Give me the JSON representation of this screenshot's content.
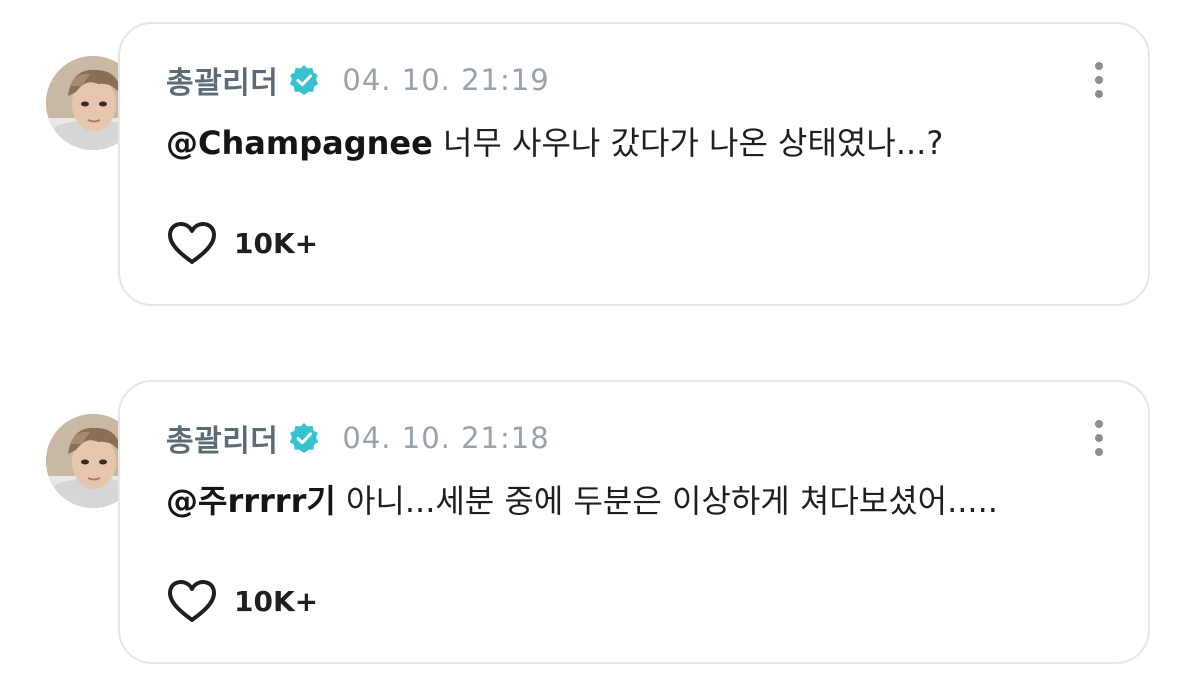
{
  "comments": [
    {
      "author": "총괄리더",
      "timestamp": "04. 10. 21:19",
      "mention": "@Champagnee",
      "text": "  너무 사우나 갔다가 나온 상태였나...?",
      "likes": "10K+"
    },
    {
      "author": "총괄리더",
      "timestamp": "04. 10. 21:18",
      "mention": "@주rrrrr기",
      "text": " 아니...세분 중에 두분은 이상하게 쳐다보셨어.....",
      "likes": "10K+"
    }
  ],
  "colors": {
    "verified_badge": "#36c2cf",
    "author": "#5d6b77",
    "timestamp": "#98a2ad",
    "card_border": "#e6e6e6"
  },
  "icons": {
    "verified": "verified-badge-icon",
    "more": "more-vertical-icon",
    "like": "heart-outline-icon"
  }
}
